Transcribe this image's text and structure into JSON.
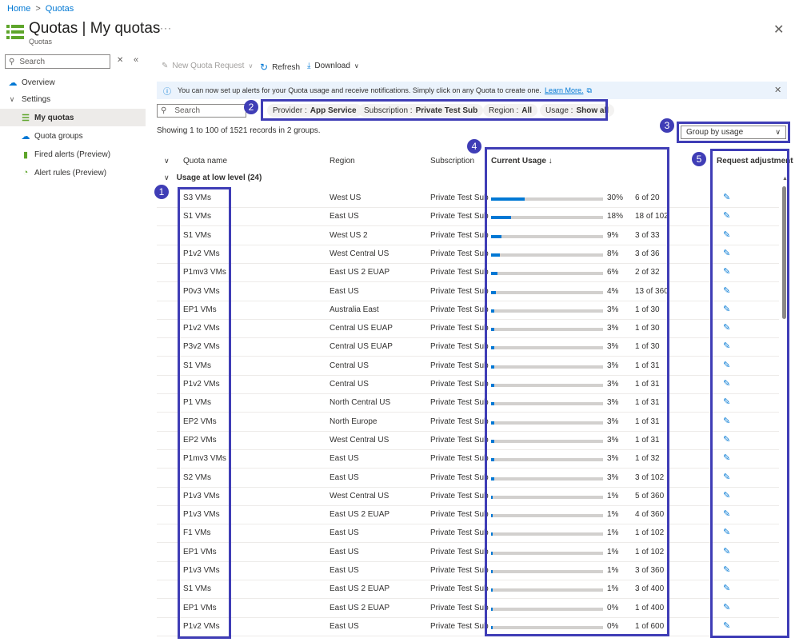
{
  "breadcrumb": {
    "home": "Home",
    "separator": ">",
    "current": "Quotas"
  },
  "header": {
    "title": "Quotas | My quotas",
    "subtitle": "Quotas",
    "more": "···",
    "close": "✕"
  },
  "sidebar": {
    "search_placeholder": "Search",
    "items": [
      {
        "label": "Overview",
        "icon": "cloud-icon"
      },
      {
        "label": "Settings",
        "icon": "chevron-down-icon"
      },
      {
        "label": "My quotas",
        "icon": "list-icon",
        "selected": true
      },
      {
        "label": "Quota groups",
        "icon": "cloud-group-icon"
      },
      {
        "label": "Fired alerts (Preview)",
        "icon": "alert-icon"
      },
      {
        "label": "Alert rules (Preview)",
        "icon": "rule-icon"
      }
    ]
  },
  "toolbar": {
    "new_request": "New Quota Request",
    "refresh": "Refresh",
    "download": "Download"
  },
  "banner": {
    "text": "You can now set up alerts for your Quota usage and receive notifications. Simply click on any Quota to create one.",
    "link": "Learn More."
  },
  "filters": {
    "search_placeholder": "Search",
    "pills": [
      {
        "key": "Provider :",
        "value": "App Service"
      },
      {
        "key": "Subscription :",
        "value": "Private Test Sub"
      },
      {
        "key": "Region :",
        "value": "All"
      },
      {
        "key": "Usage :",
        "value": "Show all"
      }
    ]
  },
  "records_text": "Showing 1 to 100 of 1521 records in 2 groups.",
  "group_by": "Group by usage",
  "columns": {
    "name": "Quota name",
    "region": "Region",
    "subscription": "Subscription",
    "usage": "Current Usage ↓",
    "adjust": "Request adjustment"
  },
  "group_label": "Usage at low level (24)",
  "badges": [
    "1",
    "2",
    "3",
    "4",
    "5"
  ],
  "colors": {
    "accent": "#0078d4",
    "highlight": "#3f3db6",
    "track": "#d2d0ce"
  },
  "rows": [
    {
      "name": "S3 VMs",
      "region": "West US",
      "subscription": "Private Test Sub",
      "pct": "30%",
      "count": "6 of 20",
      "fill": 0.3
    },
    {
      "name": "S1 VMs",
      "region": "East US",
      "subscription": "Private Test Sub",
      "pct": "18%",
      "count": "18 of 102",
      "fill": 0.18
    },
    {
      "name": "S1 VMs",
      "region": "West US 2",
      "subscription": "Private Test Sub",
      "pct": "9%",
      "count": "3 of 33",
      "fill": 0.09
    },
    {
      "name": "P1v2 VMs",
      "region": "West Central US",
      "subscription": "Private Test Sub",
      "pct": "8%",
      "count": "3 of 36",
      "fill": 0.08
    },
    {
      "name": "P1mv3 VMs",
      "region": "East US 2 EUAP",
      "subscription": "Private Test Sub",
      "pct": "6%",
      "count": "2 of 32",
      "fill": 0.06
    },
    {
      "name": "P0v3 VMs",
      "region": "East US",
      "subscription": "Private Test Sub",
      "pct": "4%",
      "count": "13 of 360",
      "fill": 0.04
    },
    {
      "name": "EP1 VMs",
      "region": "Australia East",
      "subscription": "Private Test Sub",
      "pct": "3%",
      "count": "1 of 30",
      "fill": 0.03
    },
    {
      "name": "P1v2 VMs",
      "region": "Central US EUAP",
      "subscription": "Private Test Sub",
      "pct": "3%",
      "count": "1 of 30",
      "fill": 0.03
    },
    {
      "name": "P3v2 VMs",
      "region": "Central US EUAP",
      "subscription": "Private Test Sub",
      "pct": "3%",
      "count": "1 of 30",
      "fill": 0.03
    },
    {
      "name": "S1 VMs",
      "region": "Central US",
      "subscription": "Private Test Sub",
      "pct": "3%",
      "count": "1 of 31",
      "fill": 0.03
    },
    {
      "name": "P1v2 VMs",
      "region": "Central US",
      "subscription": "Private Test Sub",
      "pct": "3%",
      "count": "1 of 31",
      "fill": 0.03
    },
    {
      "name": "P1 VMs",
      "region": "North Central US",
      "subscription": "Private Test Sub",
      "pct": "3%",
      "count": "1 of 31",
      "fill": 0.03
    },
    {
      "name": "EP2 VMs",
      "region": "North Europe",
      "subscription": "Private Test Sub",
      "pct": "3%",
      "count": "1 of 31",
      "fill": 0.03
    },
    {
      "name": "EP2 VMs",
      "region": "West Central US",
      "subscription": "Private Test Sub",
      "pct": "3%",
      "count": "1 of 31",
      "fill": 0.03
    },
    {
      "name": "P1mv3 VMs",
      "region": "East US",
      "subscription": "Private Test Sub",
      "pct": "3%",
      "count": "1 of 32",
      "fill": 0.03
    },
    {
      "name": "S2 VMs",
      "region": "East US",
      "subscription": "Private Test Sub",
      "pct": "3%",
      "count": "3 of 102",
      "fill": 0.03
    },
    {
      "name": "P1v3 VMs",
      "region": "West Central US",
      "subscription": "Private Test Sub",
      "pct": "1%",
      "count": "5 of 360",
      "fill": 0.01
    },
    {
      "name": "P1v3 VMs",
      "region": "East US 2 EUAP",
      "subscription": "Private Test Sub",
      "pct": "1%",
      "count": "4 of 360",
      "fill": 0.01
    },
    {
      "name": "F1 VMs",
      "region": "East US",
      "subscription": "Private Test Sub",
      "pct": "1%",
      "count": "1 of 102",
      "fill": 0.01
    },
    {
      "name": "EP1 VMs",
      "region": "East US",
      "subscription": "Private Test Sub",
      "pct": "1%",
      "count": "1 of 102",
      "fill": 0.01
    },
    {
      "name": "P1v3 VMs",
      "region": "East US",
      "subscription": "Private Test Sub",
      "pct": "1%",
      "count": "3 of 360",
      "fill": 0.01
    },
    {
      "name": "S1 VMs",
      "region": "East US 2 EUAP",
      "subscription": "Private Test Sub",
      "pct": "1%",
      "count": "3 of 400",
      "fill": 0.01
    },
    {
      "name": "EP1 VMs",
      "region": "East US 2 EUAP",
      "subscription": "Private Test Sub",
      "pct": "0%",
      "count": "1 of 400",
      "fill": 0.0
    },
    {
      "name": "P1v2 VMs",
      "region": "East US",
      "subscription": "Private Test Sub",
      "pct": "0%",
      "count": "1 of 600",
      "fill": 0.0
    }
  ]
}
